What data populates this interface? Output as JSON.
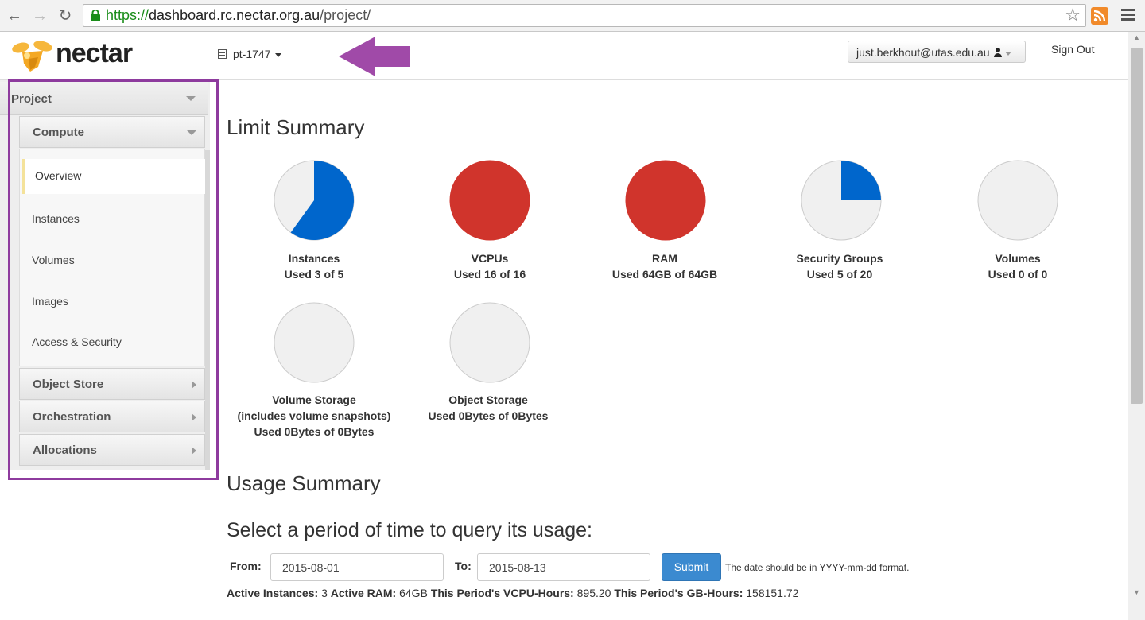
{
  "browser": {
    "url_scheme": "https://",
    "url_host": "dashboard.rc.nectar.org.au",
    "url_path": "/project/"
  },
  "header": {
    "logo_text": "nectar",
    "project_name": "pt-1747",
    "user_email": "just.berkhout@utas.edu.au",
    "sign_out_label": "Sign Out"
  },
  "sidebar": {
    "project_label": "Project",
    "compute_label": "Compute",
    "items": [
      "Overview",
      "Instances",
      "Volumes",
      "Images",
      "Access & Security"
    ],
    "groups": [
      "Object Store",
      "Orchestration",
      "Allocations"
    ]
  },
  "limit_summary": {
    "title": "Limit Summary",
    "limits": [
      {
        "name": "Instances",
        "usage": "Used 3 of 5",
        "used": 3,
        "total": 5,
        "color": "#0066cc"
      },
      {
        "name": "VCPUs",
        "usage": "Used 16 of 16",
        "used": 16,
        "total": 16,
        "color": "#d0342c"
      },
      {
        "name": "RAM",
        "usage": "Used 64GB of 64GB",
        "used": 64,
        "total": 64,
        "color": "#d0342c"
      },
      {
        "name": "Security Groups",
        "usage": "Used 5 of 20",
        "used": 5,
        "total": 20,
        "color": "#0066cc"
      },
      {
        "name": "Volumes",
        "usage": "Used 0 of 0",
        "used": 0,
        "total": 0,
        "color": "#0066cc"
      },
      {
        "name": "Volume Storage",
        "subname": "(includes volume snapshots)",
        "usage": "Used 0Bytes of 0Bytes",
        "used": 0,
        "total": 0,
        "color": "#0066cc"
      },
      {
        "name": "Object Storage",
        "usage": "Used 0Bytes of 0Bytes",
        "used": 0,
        "total": 0,
        "color": "#0066cc"
      }
    ],
    "empty_color": "#f0f0f0",
    "border_color": "#cccccc"
  },
  "usage_summary": {
    "title": "Usage Summary",
    "query_title": "Select a period of time to query its usage:",
    "from_label": "From:",
    "from_value": "2015-08-01",
    "to_label": "To:",
    "to_value": "2015-08-13",
    "submit_label": "Submit",
    "help_text": "The date should be in YYYY-mm-dd format.",
    "stats": [
      {
        "label": "Active Instances:",
        "value": "3"
      },
      {
        "label": "Active RAM:",
        "value": "64GB"
      },
      {
        "label": "This Period's VCPU-Hours:",
        "value": "895.20"
      },
      {
        "label": "This Period's GB-Hours:",
        "value": "158151.72"
      }
    ]
  }
}
